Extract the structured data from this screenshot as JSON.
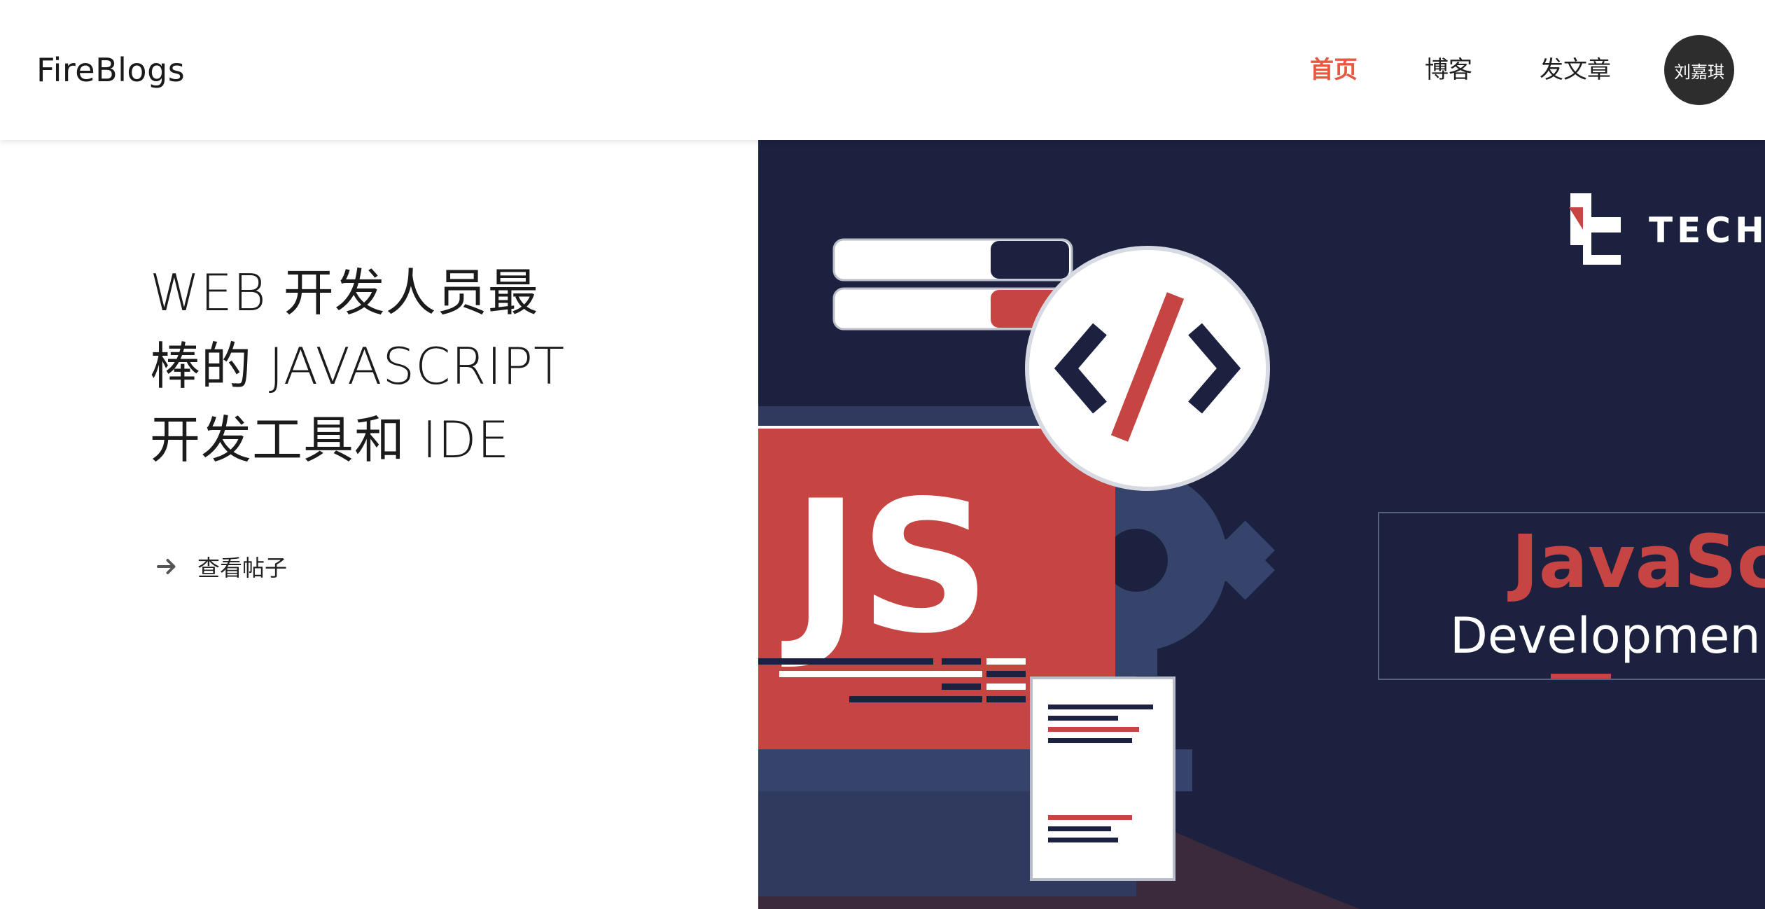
{
  "header": {
    "brand": "FireBlogs",
    "nav": [
      {
        "label": "首页",
        "active": true
      },
      {
        "label": "博客",
        "active": false
      },
      {
        "label": "发文章",
        "active": false
      }
    ],
    "user": {
      "name": "刘嘉琪"
    }
  },
  "hero": {
    "title_lines": [
      "WEB 开发人员最",
      "棒的 JAVASCRIPT",
      "开发工具和 IDE"
    ],
    "link_label": "查看帖子",
    "link_icon": "arrow-right-icon",
    "image": {
      "badge_text": "JS",
      "logo_text": "TECH",
      "banner_title": "JavaScr",
      "banner_subtitle": "Developmen"
    }
  },
  "colors": {
    "accent": "#e8573f",
    "image_bg": "#1c2140",
    "image_red": "#c64542",
    "avatar_bg": "#2d2d2d"
  }
}
